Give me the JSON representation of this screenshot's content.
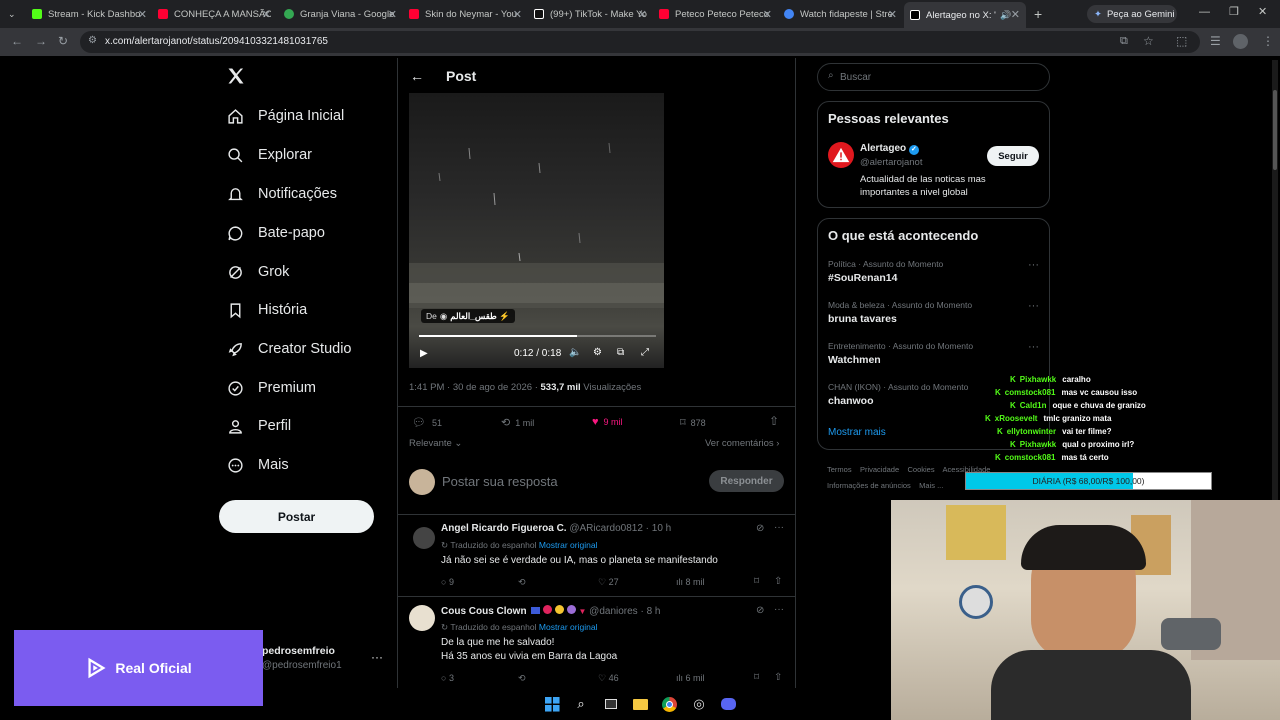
{
  "tabs": [
    {
      "label": "Stream - Kick Dashbo",
      "color": "#53fc18"
    },
    {
      "label": "CONHEÇA A MANSÃO",
      "color": "#ff0033"
    },
    {
      "label": "Granja Viana - Google",
      "color": "#34a853"
    },
    {
      "label": "Skin do Neymar - You",
      "color": "#ff0033"
    },
    {
      "label": "(99+) TikTok - Make Yo",
      "color": "#ffffff"
    },
    {
      "label": "Peteco Peteco Peteco",
      "color": "#ff0033"
    },
    {
      "label": "Watch fidapeste | Stre",
      "color": "#4285f4"
    },
    {
      "label": "Alertageo no X: \"I",
      "color": "#ffffff"
    }
  ],
  "gemini_label": "Peça ao Gemini",
  "url": "x.com/alertarojanot/status/2094103321481031765",
  "nav": {
    "items": [
      "Página Inicial",
      "Explorar",
      "Notificações",
      "Bate-papo",
      "Grok",
      "História",
      "Creator Studio",
      "Premium",
      "Perfil",
      "Mais"
    ],
    "post_button": "Postar",
    "user_name": "pedrosemfreio",
    "user_handle": "@pedrosemfreio1"
  },
  "header": {
    "title": "Post"
  },
  "video": {
    "source": "De",
    "source_name": "طقس_العالم ⚡",
    "time": "0:12 / 0:18",
    "progress": 0.667
  },
  "post_meta": {
    "time": "1:41 PM · 30 de ago de 2026 · ",
    "views": "533,7 mil",
    "views_label": " Visualizações"
  },
  "actions": {
    "replies": "51",
    "reposts": "1 mil",
    "likes": "9 mil",
    "bookmarks": "878"
  },
  "sort": {
    "relevant": "Relevante",
    "comments": "Ver comentários"
  },
  "compose": {
    "placeholder": "Postar sua resposta",
    "button": "Responder"
  },
  "replies": [
    {
      "name": "Angel Ricardo Figueroa C.",
      "handle": "@ARicardo0812 · 10 h",
      "translated": "Traduzido do espanhol",
      "original": "Mostrar original",
      "text": "Já não sei se é verdade ou IA, mas o planeta se manifestando",
      "replies": "9",
      "likes": "27",
      "views": "8 mil"
    },
    {
      "name": "Cous Cous Clown",
      "handle": "@daniores · 8 h",
      "translated": "Traduzido do espanhol",
      "original": "Mostrar original",
      "text": "De la que me he salvado!",
      "text2": "Há 35 anos eu vivia em Barra da Lagoa",
      "replies": "3",
      "likes": "46",
      "views": "6 mil"
    }
  ],
  "search": {
    "placeholder": "Buscar"
  },
  "relevant": {
    "title": "Pessoas relevantes",
    "name": "Alertageo",
    "handle": "@alertarojanot",
    "bio": "Actualidad de las noticas mas importantes a nivel global",
    "follow": "Seguir"
  },
  "trending": {
    "title": "O que está acontecendo",
    "items": [
      {
        "category": "Política · Assunto do Momento",
        "name": "#SouRenan14"
      },
      {
        "category": "Moda & beleza · Assunto do Momento",
        "name": "bruna tavares"
      },
      {
        "category": "Entretenimento · Assunto do Momento",
        "name": "Watchmen"
      },
      {
        "category": "CHAN (IKON) · Assunto do Momento",
        "name": "chanwoo"
      }
    ],
    "show_more": "Mostrar mais"
  },
  "footer": {
    "terms": "Termos",
    "privacy": "Privacidade",
    "cookies": "Cookies",
    "access": "Acessibilidade",
    "ads": "Informações de anúncios",
    "more": "Mais ..."
  },
  "chat": [
    {
      "user": "Pixhawkk",
      "msg": "caralho"
    },
    {
      "user": "comstock081",
      "msg": "mas vc causou isso"
    },
    {
      "user": "Cald1n",
      "msg": "oque e chuva de granizo"
    },
    {
      "user": "xRoosevelt",
      "msg": "tmlc granizo mata"
    },
    {
      "user": "ellytonwinter",
      "msg": "vai ter filme?"
    },
    {
      "user": "Pixhawkk",
      "msg": "qual o proximo irl?"
    },
    {
      "user": "comstock081",
      "msg": "mas tá certo"
    }
  ],
  "goal": {
    "label": "DIÁRIA (R$ 68,00/R$ 100,00)",
    "progress": 0.68
  },
  "overlay": {
    "brand": "Real Oficial",
    "brand_color": "#7b5cf0"
  }
}
